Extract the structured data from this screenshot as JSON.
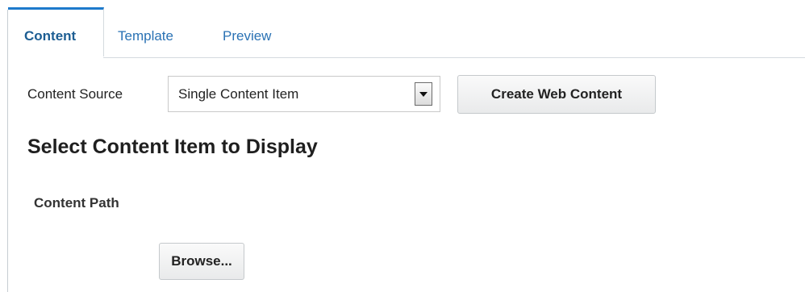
{
  "tabs": [
    {
      "label": "Content",
      "active": true
    },
    {
      "label": "Template",
      "active": false
    },
    {
      "label": "Preview",
      "active": false
    }
  ],
  "content_source": {
    "label": "Content Source",
    "selected": "Single Content Item"
  },
  "buttons": {
    "create_web_content": "Create Web Content",
    "browse": "Browse..."
  },
  "section": {
    "heading": "Select Content Item to Display",
    "content_path_label": "Content Path"
  },
  "colors": {
    "accent": "#1e7acc",
    "link": "#2a72b4",
    "active_tab_text": "#1d5e93"
  }
}
